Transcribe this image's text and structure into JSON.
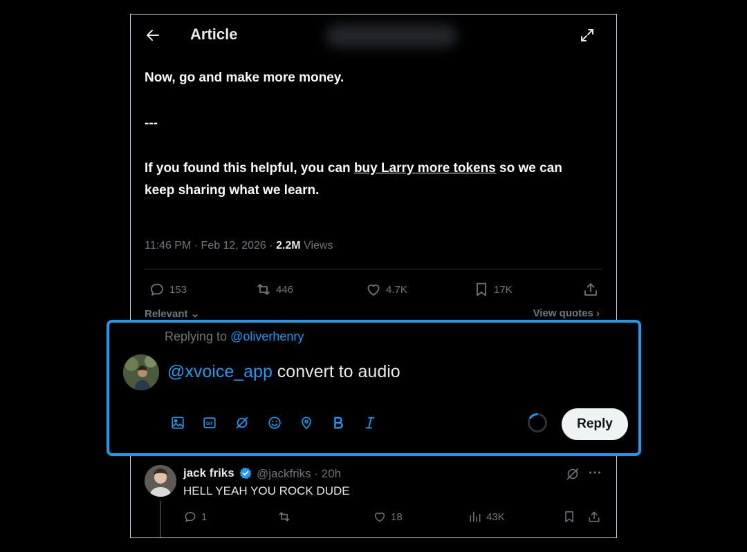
{
  "header": {
    "title": "Article"
  },
  "article": {
    "p1": "Now, go and make more money.",
    "p2": "---",
    "p3_before": "If you found this helpful, you can ",
    "p3_link": "buy Larry more tokens",
    "p3_after": " so we can",
    "p4": "keep sharing what we learn."
  },
  "meta": {
    "datetime": "11:46 PM · Feb 12, 2026 · ",
    "views_count": "2.2M",
    "views_label": " Views"
  },
  "stats": {
    "replies": "153",
    "reposts": "446",
    "likes": "4.7K",
    "bookmarks": "17K"
  },
  "sort": {
    "relevant": "Relevant",
    "view_quotes": "View quotes"
  },
  "composer": {
    "replying_to_label": "Replying to ",
    "replying_to_handle": "@oliverhenry",
    "mention": "@xvoice_app",
    "text": " convert to audio",
    "reply_label": "Reply"
  },
  "comment": {
    "name": "jack friks",
    "handle": "@jackfriks · 20h",
    "text": "HELL YEAH YOU ROCK DUDE",
    "replies": "1",
    "likes": "18",
    "views": "43K"
  },
  "colors": {
    "accent": "#1d9bf0",
    "muted": "#71767b",
    "text": "#e7e9ea",
    "background": "#000000"
  },
  "icons": [
    "back-arrow-icon",
    "expand-icon",
    "reply-icon",
    "repost-icon",
    "like-icon",
    "bookmark-icon",
    "share-icon",
    "image-icon",
    "gif-icon",
    "grok-icon",
    "emoji-icon",
    "location-icon",
    "bold-icon",
    "italic-icon",
    "verified-badge-icon",
    "more-icon",
    "views-icon"
  ]
}
